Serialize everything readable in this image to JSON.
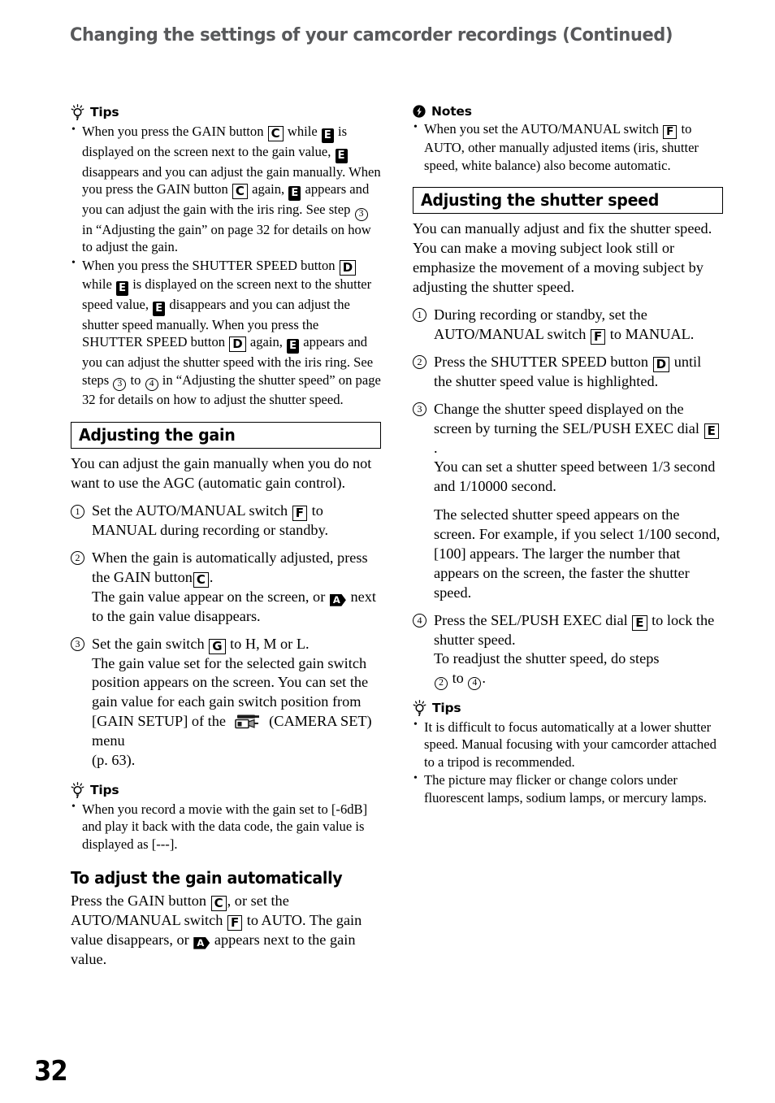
{
  "page": {
    "header_title": "Changing the settings of your camcorder recordings (Continued)",
    "page_number": "32"
  },
  "icons": {
    "tips": "lightbulb-icon",
    "notes": "exclamation-bolt-icon",
    "camera_set_menu": "camcorder-icon",
    "badge_e": "E",
    "badge_a": "A"
  },
  "left_column": {
    "tips_heading": "Tips",
    "tips": [
      {
        "p1": "When you press the GAIN button",
        "k1": "C",
        "p2": "while",
        "b1": "E",
        "p3": "is displayed on the screen next to the gain value,",
        "b2": "E",
        "p4": "disappears and you can adjust the gain manually. When you press the GAIN button",
        "k2": "C",
        "p5": "again,",
        "b3": "E",
        "p6": "appears and you can adjust the gain with the iris ring. See step",
        "c1": "3",
        "p7": "in “Adjusting the gain” on page 32 for details on how to adjust the gain."
      },
      {
        "p1": "When you press the SHUTTER SPEED button",
        "k1": "D",
        "p2": "while",
        "b1": "E",
        "p3": "is displayed on the screen next to the shutter speed value,",
        "b2": "E",
        "p4": "disappears and you can adjust the shutter speed manually. When you press the SHUTTER SPEED button",
        "k2": "D",
        "p5": "again,",
        "b3": "E",
        "p6": "appears and you can adjust the shutter speed with the iris ring. See steps",
        "c1": "3",
        "p7": "to",
        "c2": "4",
        "p8": "in “Adjusting the shutter speed” on page 32 for details on how to adjust the shutter speed."
      }
    ],
    "gain_section": {
      "title": "Adjusting the gain",
      "intro": "You can adjust the gain manually when you do not want to use the AGC (automatic gain control).",
      "steps": [
        {
          "num": "1",
          "p1": "Set the AUTO/MANUAL switch",
          "k1": "F",
          "p2": "to MANUAL during recording or standby."
        },
        {
          "num": "2",
          "p1": "When the gain is automatically adjusted, press the GAIN button",
          "k1": "C",
          "p2": ".",
          "extra_pre": "The gain value appear on the screen, or",
          "badge": "A",
          "extra_post": "next to the gain value disappears."
        },
        {
          "num": "3",
          "p1": "Set the gain switch",
          "k1": "G",
          "p2": "to H, M or L.",
          "extra_pre": "The gain value set for the selected gain switch position appears on the screen. You can set the gain value for each gain switch position from [GAIN SETUP] of the",
          "extra_mid": "(CAMERA SET) menu",
          "extra_post": "(p. 63)."
        }
      ]
    },
    "gain_tips_heading": "Tips",
    "gain_tips": [
      "When you record a movie with the gain set to [-6dB] and play it back with the data code, the gain value is displayed as [---]."
    ],
    "auto_gain_section": {
      "title": "To adjust the gain automatically",
      "p1": "Press the GAIN button",
      "k1": "C",
      "p2": ", or set the AUTO/MANUAL switch",
      "k2": "F",
      "p3": "to AUTO. The gain value disappears, or",
      "badge": "A",
      "p4": "appears next to the gain value."
    }
  },
  "right_column": {
    "notes_heading": "Notes",
    "notes": [
      {
        "p1": "When you set the AUTO/MANUAL switch",
        "k1": "F",
        "p2": "to AUTO, other manually adjusted items (iris, shutter speed, white balance) also become automatic."
      }
    ],
    "shutter_section": {
      "title": "Adjusting the shutter speed",
      "intro": "You can manually adjust and fix the shutter speed. You can make a moving subject look still or emphasize the movement of a moving subject by adjusting the shutter speed.",
      "steps": [
        {
          "num": "1",
          "p1": "During recording or standby, set the AUTO/MANUAL switch",
          "k1": "F",
          "p2": "to MANUAL."
        },
        {
          "num": "2",
          "p1": "Press the SHUTTER SPEED button",
          "k1": "D",
          "p2": "until the shutter speed value is highlighted."
        },
        {
          "num": "3",
          "p1": "Change the shutter speed displayed on the screen by turning the SEL/PUSH EXEC dial",
          "k1": "E",
          "p2": ".",
          "extra": "You can set a shutter speed between 1/3 second and 1/10000 second.",
          "para": "The selected shutter speed appears on the screen. For example, if you select 1/100 second, [100] appears. The larger the number that appears on the screen, the faster the shutter speed."
        },
        {
          "num": "4",
          "p1": "Press the SEL/PUSH EXEC dial",
          "k1": "E",
          "p2": "to lock the shutter speed.",
          "extra": "To readjust the shutter speed, do steps",
          "c1": "2",
          "extra_mid": "to",
          "c2": "4",
          "extra_post": "."
        }
      ]
    },
    "shutter_tips_heading": "Tips",
    "shutter_tips": [
      "It is difficult to focus automatically at a lower shutter speed. Manual focusing with your camcorder attached to a tripod is recommended.",
      "The picture may flicker or change colors under fluorescent lamps, sodium lamps, or mercury lamps."
    ]
  }
}
